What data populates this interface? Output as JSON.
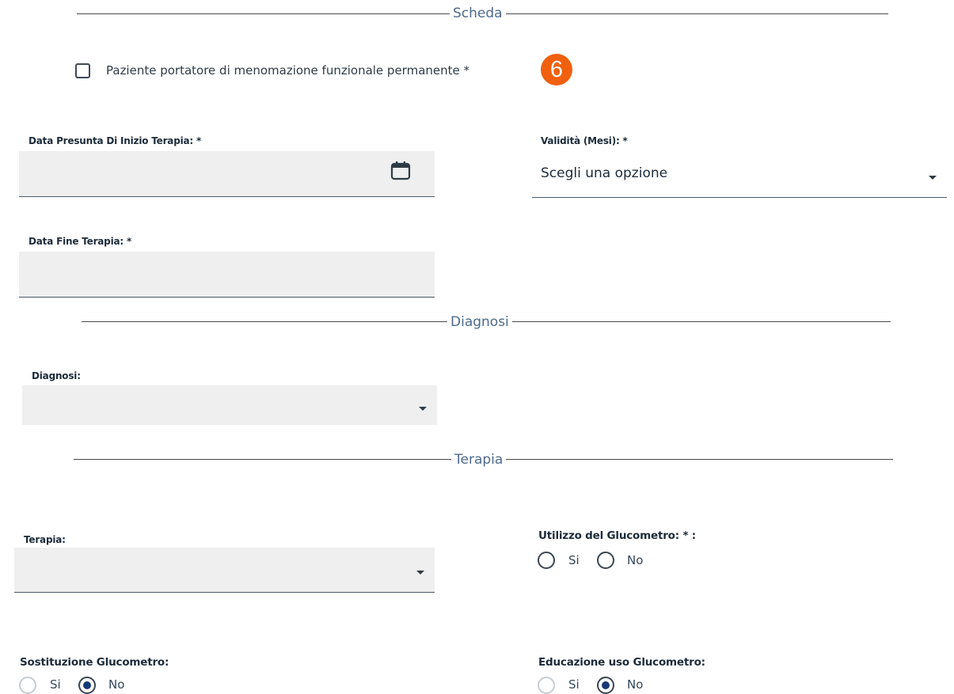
{
  "sections": {
    "scheda": "Scheda",
    "diagnosi": "Diagnosi",
    "terapia": "Terapia"
  },
  "checkbox": {
    "label": "Paziente portatore di menomazione funzionale permanente *",
    "checked": false,
    "badge": "6"
  },
  "fields": {
    "data_inizio": {
      "label": "Data Presunta Di Inizio Terapia: *",
      "value": ""
    },
    "validita": {
      "label": "Validità (Mesi): *",
      "value": "Scegli una opzione"
    },
    "data_fine": {
      "label": "Data Fine Terapia: *",
      "value": ""
    },
    "diagnosi": {
      "label": "Diagnosi:",
      "value": ""
    },
    "terapia": {
      "label": "Terapia:",
      "value": ""
    }
  },
  "radios": {
    "utilizzo": {
      "label": "Utilizzo del Glucometro: * :",
      "options": [
        "Si",
        "No"
      ],
      "selected": ""
    },
    "sostituzione": {
      "label": "Sostituzione Glucometro:",
      "options": [
        "Si",
        "No"
      ],
      "selected": "No"
    },
    "educazione": {
      "label": "Educazione uso Glucometro:",
      "options": [
        "Si",
        "No"
      ],
      "selected": "No"
    }
  },
  "colors": {
    "accent_badge": "#f0600e",
    "radio_selected": "#173a78",
    "section_title": "#4d6a8c"
  }
}
